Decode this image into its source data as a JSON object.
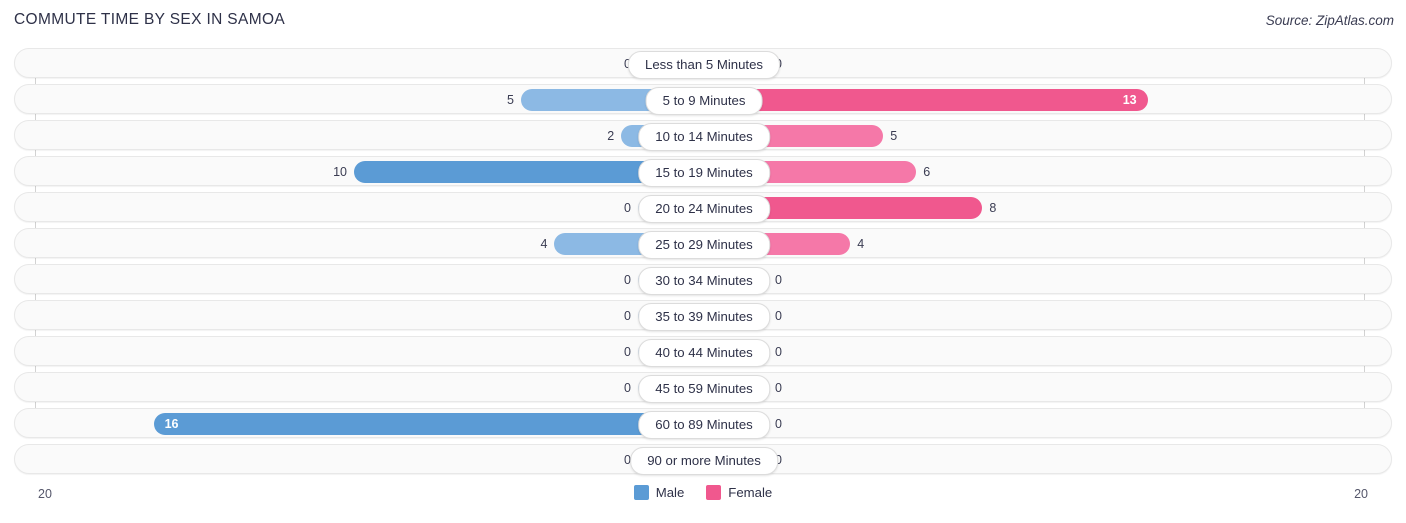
{
  "header": {
    "title": "COMMUTE TIME BY SEX IN SAMOA",
    "source": "Source: ZipAtlas.com"
  },
  "axis": {
    "left_tick": "20",
    "right_tick": "20"
  },
  "legend": {
    "items": [
      {
        "label": "Male",
        "color": "#5b9bd5"
      },
      {
        "label": "Female",
        "color": "#f0588e"
      }
    ]
  },
  "colors": {
    "male_strong": "#5b9bd5",
    "male_mid": "#8cb9e4",
    "male_light": "#aecbeb",
    "female_strong": "#f0588e",
    "female_mid": "#f578a8",
    "female_light": "#f7a8c4",
    "row_bg": "#fafafa",
    "row_border": "#e8e8e8",
    "title": "#2e3148"
  },
  "chart_data": {
    "type": "bar",
    "title": "COMMUTE TIME BY SEX IN SAMOA",
    "orientation": "horizontal-diverging",
    "xlabel": "",
    "ylabel": "",
    "xlim": [
      20,
      20
    ],
    "grid": false,
    "legend_position": "bottom-center",
    "categories": [
      "Less than 5 Minutes",
      "5 to 9 Minutes",
      "10 to 14 Minutes",
      "15 to 19 Minutes",
      "20 to 24 Minutes",
      "25 to 29 Minutes",
      "30 to 34 Minutes",
      "35 to 39 Minutes",
      "40 to 44 Minutes",
      "45 to 59 Minutes",
      "60 to 89 Minutes",
      "90 or more Minutes"
    ],
    "series": [
      {
        "name": "Male",
        "values": [
          0,
          5,
          2,
          10,
          0,
          4,
          0,
          0,
          0,
          0,
          16,
          0
        ]
      },
      {
        "name": "Female",
        "values": [
          0,
          13,
          5,
          6,
          8,
          4,
          0,
          0,
          0,
          0,
          0,
          0
        ]
      }
    ]
  },
  "rows": [
    {
      "label": "Less than 5 Minutes",
      "male": "0",
      "female": "0"
    },
    {
      "label": "5 to 9 Minutes",
      "male": "5",
      "female": "13"
    },
    {
      "label": "10 to 14 Minutes",
      "male": "2",
      "female": "5"
    },
    {
      "label": "15 to 19 Minutes",
      "male": "10",
      "female": "6"
    },
    {
      "label": "20 to 24 Minutes",
      "male": "0",
      "female": "8"
    },
    {
      "label": "25 to 29 Minutes",
      "male": "4",
      "female": "4"
    },
    {
      "label": "30 to 34 Minutes",
      "male": "0",
      "female": "0"
    },
    {
      "label": "35 to 39 Minutes",
      "male": "0",
      "female": "0"
    },
    {
      "label": "40 to 44 Minutes",
      "male": "0",
      "female": "0"
    },
    {
      "label": "45 to 59 Minutes",
      "male": "0",
      "female": "0"
    },
    {
      "label": "60 to 89 Minutes",
      "male": "16",
      "female": "0"
    },
    {
      "label": "90 or more Minutes",
      "male": "0",
      "female": "0"
    }
  ]
}
